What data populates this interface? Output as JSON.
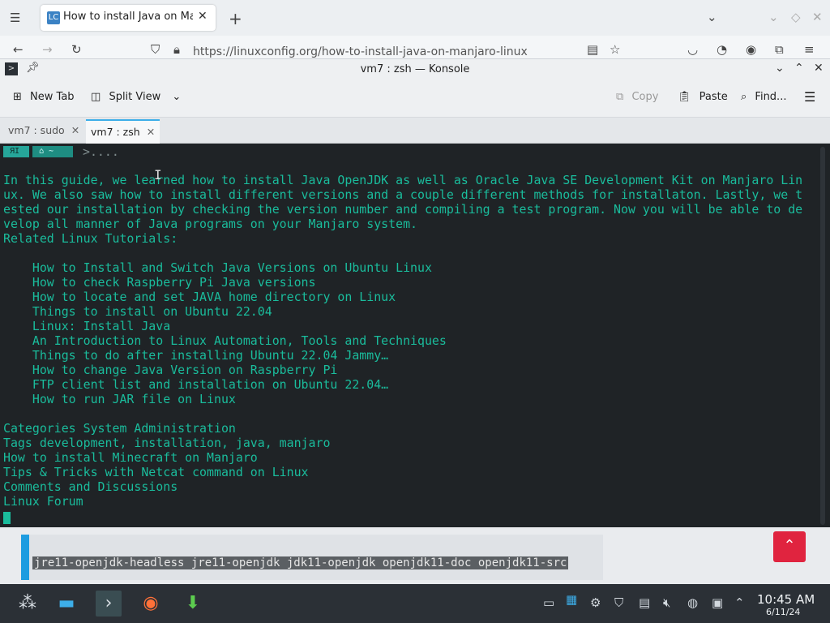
{
  "firefox": {
    "tab_title": "How to install Java on Manjaro",
    "url": "https://linuxconfig.org/how-to-install-java-on-manjaro-linux",
    "favicon": "LC"
  },
  "konsole": {
    "window_title": "vm7 : zsh — Konsole",
    "toolbar": {
      "new_tab": "New Tab",
      "split_view": "Split View",
      "copy": "Copy",
      "paste": "Paste",
      "find": "Find..."
    },
    "tabs": [
      {
        "label": "vm7 : sudo",
        "active": false
      },
      {
        "label": "vm7 : zsh",
        "active": true
      }
    ],
    "prompt": {
      "seg1": "ЯI",
      "seg2": "⌂ ~",
      "dots": ">...."
    },
    "lines": [
      "In this guide, we learned how to install Java OpenJDK as well as Oracle Java SE Development Kit on Manjaro Lin",
      "ux. We also saw how to install different versions and a couple different methods for installaton. Lastly, we t",
      "ested our installation by checking the version number and compiling a test program. Now you will be able to de",
      "velop all manner of Java programs on your Manjaro system.",
      "Related Linux Tutorials:",
      "",
      "    How to Install and Switch Java Versions on Ubuntu Linux",
      "    How to check Raspberry Pi Java versions",
      "    How to locate and set JAVA home directory on Linux",
      "    Things to install on Ubuntu 22.04",
      "    Linux: Install Java",
      "    An Introduction to Linux Automation, Tools and Techniques",
      "    Things to do after installing Ubuntu 22.04 Jammy…",
      "    How to change Java Version on Raspberry Pi",
      "    FTP client list and installation on Ubuntu 22.04…",
      "    How to run JAR file on Linux",
      "",
      "Categories System Administration",
      "Tags development, installation, java, manjaro",
      "How to install Minecraft on Manjaro",
      "Tips & Tricks with Netcat command on Linux",
      "Comments and Discussions",
      "Linux Forum"
    ]
  },
  "page_below": {
    "code": "jre11-openjdk-headless jre11-openjdk jdk11-openjdk openjdk11-doc openjdk11-src"
  },
  "taskbar": {
    "time": "10:45 AM",
    "date": "6/11/24"
  },
  "colors": {
    "terminal_bg": "#1f2326",
    "terminal_fg": "#1abc9c",
    "accent": "#3daee9",
    "scroll_top_button": "#e0243f"
  }
}
